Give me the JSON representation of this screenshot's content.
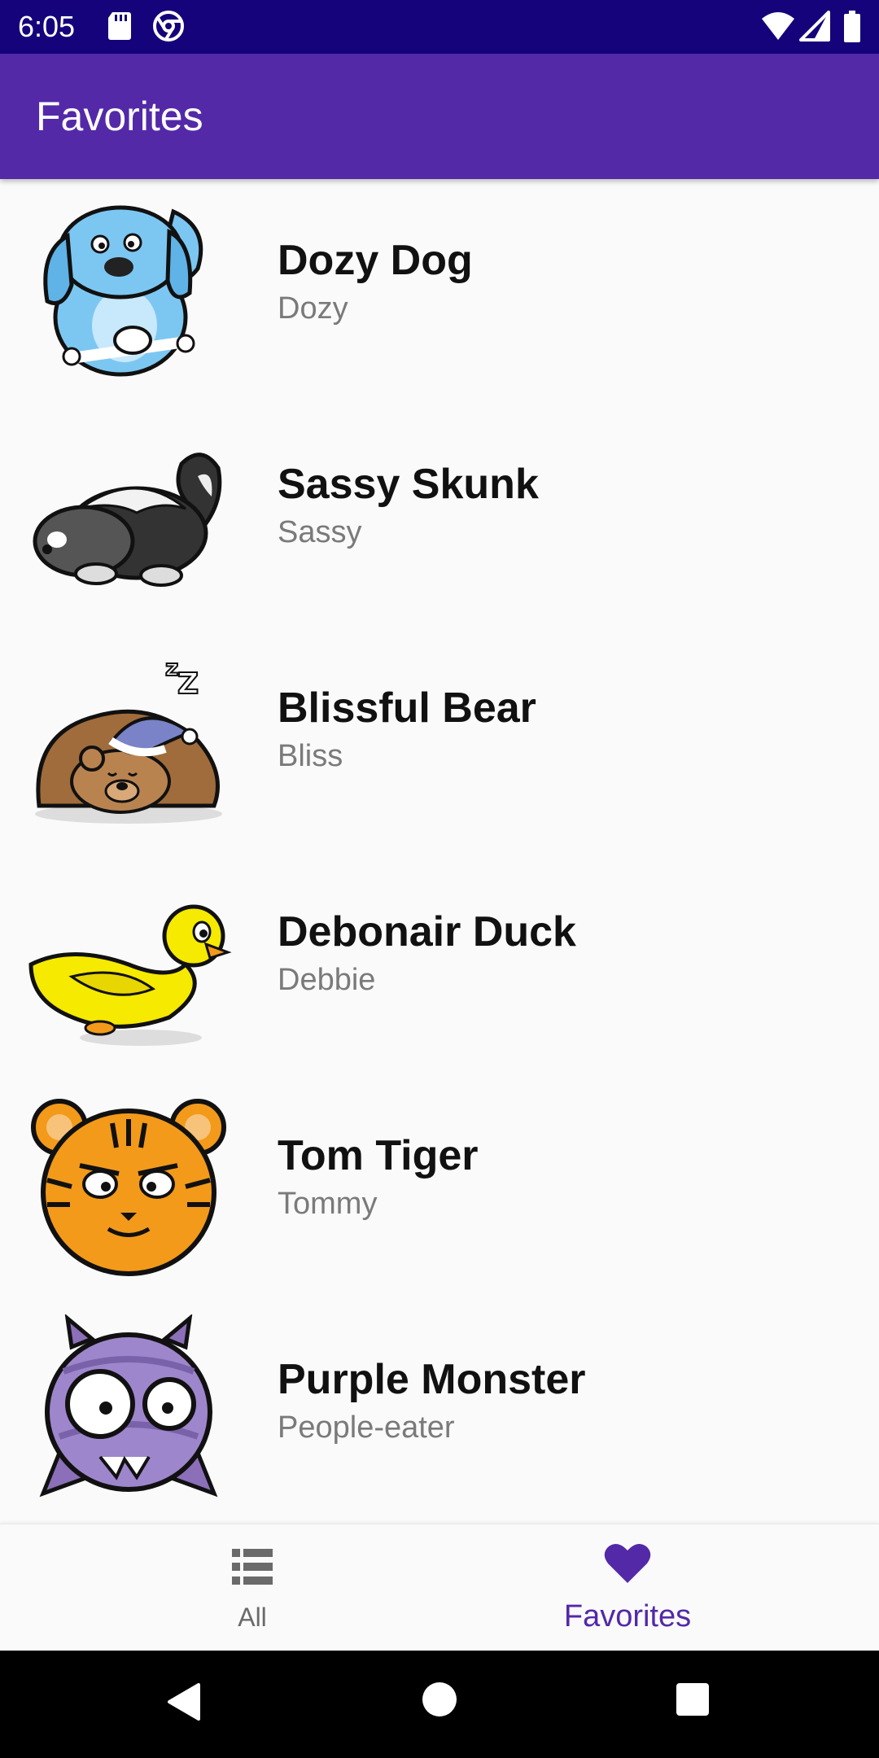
{
  "status_bar": {
    "time": "6:05",
    "left_icons": [
      "sd-card-icon",
      "chrome-icon"
    ],
    "right_icons": [
      "wifi-icon",
      "cell-signal-icon",
      "battery-icon"
    ]
  },
  "app_bar": {
    "title": "Favorites"
  },
  "list": {
    "items": [
      {
        "name": "Dozy Dog",
        "nickname": "Dozy",
        "icon": "dog-icon"
      },
      {
        "name": "Sassy Skunk",
        "nickname": "Sassy",
        "icon": "skunk-icon"
      },
      {
        "name": "Blissful Bear",
        "nickname": "Bliss",
        "icon": "bear-icon"
      },
      {
        "name": "Debonair Duck",
        "nickname": "Debbie",
        "icon": "duck-icon"
      },
      {
        "name": "Tom Tiger",
        "nickname": "Tommy",
        "icon": "tiger-icon"
      },
      {
        "name": "Purple Monster",
        "nickname": "People-eater",
        "icon": "monster-icon"
      }
    ]
  },
  "bottom_nav": {
    "items": [
      {
        "label": "All",
        "icon": "list-icon",
        "selected": false
      },
      {
        "label": "Favorites",
        "icon": "heart-icon",
        "selected": true
      }
    ]
  },
  "colors": {
    "status_bar": "#14037a",
    "app_bar": "#5329a8",
    "accent": "#5329a8",
    "background": "#fafafa"
  },
  "system_nav": [
    "back-icon",
    "home-icon",
    "recents-icon"
  ]
}
